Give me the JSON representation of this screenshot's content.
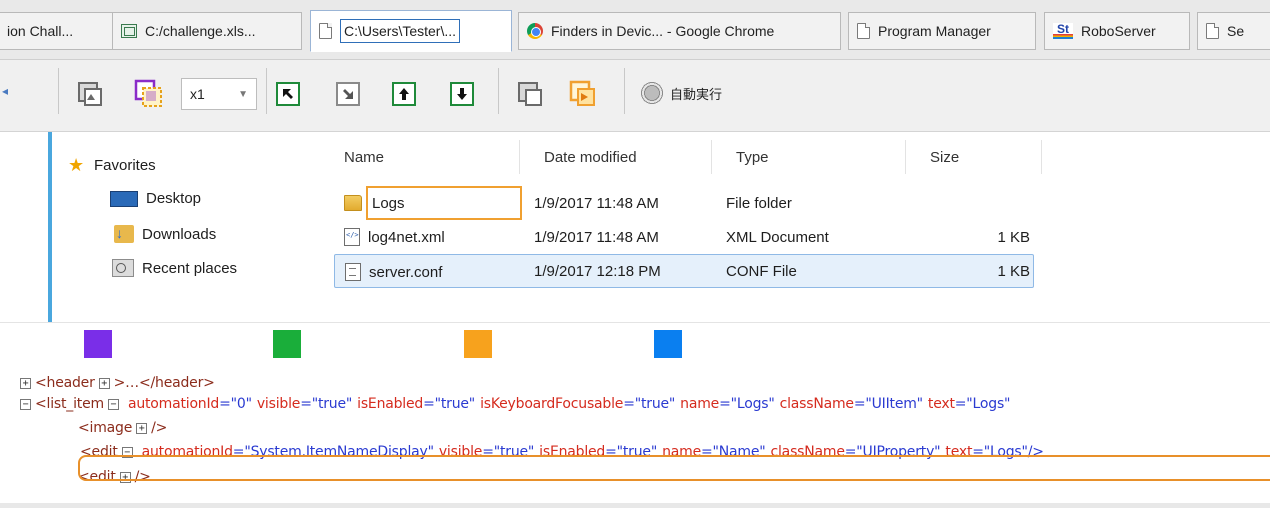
{
  "tabs": [
    {
      "label": "ion Chall...",
      "icon": "document-icon"
    },
    {
      "label": "C:/challenge.xls...",
      "icon": "spreadsheet-icon"
    },
    {
      "label": "C:\\Users\\Tester\\...",
      "icon": "document-icon",
      "active": true
    },
    {
      "label": "Finders in Devic... - Google Chrome",
      "icon": "chrome-icon"
    },
    {
      "label": "Program Manager",
      "icon": "document-icon"
    },
    {
      "label": "RoboServer",
      "icon": "roboserver-icon"
    },
    {
      "label": "Se",
      "icon": "document-icon"
    }
  ],
  "toolbar": {
    "zoom_value": "x1",
    "auto_run_label": "自動実行"
  },
  "nav": {
    "favorites": "Favorites",
    "items": [
      "Desktop",
      "Downloads",
      "Recent places"
    ]
  },
  "files": {
    "columns": [
      "Name",
      "Date modified",
      "Type",
      "Size"
    ],
    "rows": [
      {
        "name": "Logs",
        "date": "1/9/2017 11:48 AM",
        "type": "File folder",
        "size": "",
        "icon": "folder-icon"
      },
      {
        "name": "log4net.xml",
        "date": "1/9/2017 11:48 AM",
        "type": "XML Document",
        "size": "1 KB",
        "icon": "xml-file-icon"
      },
      {
        "name": "server.conf",
        "date": "1/9/2017 12:18 PM",
        "type": "CONF File",
        "size": "1 KB",
        "icon": "conf-file-icon"
      }
    ]
  },
  "swatches": {
    "colors": [
      "#7a2ee8",
      "#1aae3a",
      "#f7a21d",
      "#0a7ff0"
    ]
  },
  "xml": {
    "line1": {
      "expander": "+",
      "open": "<header",
      "expander2": "+",
      "rest": ">…</header>"
    },
    "line2": {
      "expander": "−",
      "tag": "<list_item",
      "attrs": [
        {
          "k": "automationId",
          "v": "\"0\""
        },
        {
          "k": "visible",
          "v": "\"true\""
        },
        {
          "k": "isEnabled",
          "v": "\"true\""
        },
        {
          "k": "isKeyboardFocusable",
          "v": "\"true\""
        },
        {
          "k": "name",
          "v": "\"Logs\""
        },
        {
          "k": "className",
          "v": "\"UIItem\""
        },
        {
          "k": "text",
          "v": "\"Logs\""
        }
      ]
    },
    "line3": {
      "tag": "<image",
      "close": "/>"
    },
    "line4": {
      "tag": "<edit",
      "attrs": [
        {
          "k": "automationId",
          "v": "\"System.ItemNameDisplay\""
        },
        {
          "k": "visible",
          "v": "\"true\""
        },
        {
          "k": "isEnabled",
          "v": "\"true\""
        },
        {
          "k": "name",
          "v": "\"Name\""
        },
        {
          "k": "className",
          "v": "\"UIProperty\""
        },
        {
          "k": "text",
          "v": "\"Logs\"/>"
        }
      ]
    },
    "line5": {
      "tag": "<edit",
      "close": "/>"
    }
  }
}
